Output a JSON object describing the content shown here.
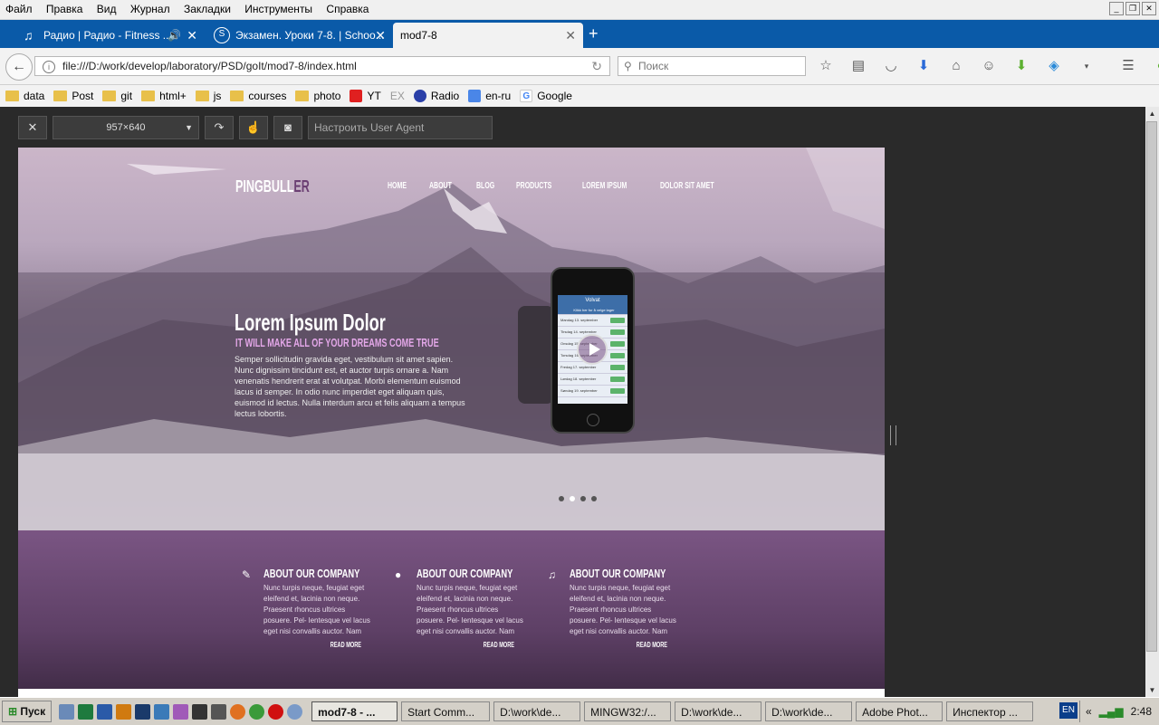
{
  "menu": [
    "Файл",
    "Правка",
    "Вид",
    "Журнал",
    "Закладки",
    "Инструменты",
    "Справка"
  ],
  "tabs": [
    {
      "label": "Радио | Радио - Fitness ...",
      "active": false
    },
    {
      "label": "Экзамен. Уроки 7-8. | Schoo...",
      "active": false
    },
    {
      "label": "mod7-8",
      "active": true
    }
  ],
  "newtab": "+",
  "url": "file:///D:/work/develop/laboratory/PSD/goIt/mod7-8/index.html",
  "search_placeholder": "Поиск",
  "bookmarks": [
    {
      "label": "data",
      "type": "folder"
    },
    {
      "label": "Post",
      "type": "folder"
    },
    {
      "label": "git",
      "type": "folder"
    },
    {
      "label": "html+",
      "type": "folder"
    },
    {
      "label": "js",
      "type": "folder"
    },
    {
      "label": "courses",
      "type": "folder"
    },
    {
      "label": "photo",
      "type": "folder"
    },
    {
      "label": "YT",
      "type": "youtube"
    },
    {
      "label": "EX",
      "type": "text"
    },
    {
      "label": "Radio",
      "type": "radio"
    },
    {
      "label": "en-ru",
      "type": "translate"
    },
    {
      "label": "Google",
      "type": "google"
    }
  ],
  "rdm": {
    "size": "957×640",
    "ua_placeholder": "Настроить User Agent"
  },
  "site": {
    "logo_a": "PINGBULL",
    "logo_b": "ER",
    "nav": [
      "HOME",
      "ABOUT",
      "BLOG",
      "PRODUCTS",
      "LOREM IPSUM",
      "DOLOR SIT AMET"
    ],
    "hero_title": "Lorem Ipsum Dolor",
    "hero_sub": "IT WILL MAKE ALL OF YOUR DREAMS COME TRUE",
    "hero_text": "Semper sollicitudin gravida eget, vestibulum sit amet sapien. Nunc dignissim tincidunt est, et auctor turpis ornare a. Nam venenatis hendrerit erat at volutpat. Morbi elementum euismod lacus id semper. In odio nunc imperdiet eget aliquam quis, euismod id lectus. Nulla interdum arcu et felis aliquam a tempus lectus lobortis.",
    "phone_header": "Volvat",
    "phone_button": "Klikk her for å velge lager",
    "phone_rows": [
      "Mandag 13. september",
      "Tirsdag 14. september",
      "Onsdag 15. september",
      "Torsdag 16. september",
      "Fredag 17. september",
      "Lørdag 18. september",
      "Søndag 19. september"
    ],
    "features": [
      {
        "title": "ABOUT OUR COMPANY",
        "text": "Nunc turpis neque, feugiat eget eleifend et, lacinia non neque. Praesent rhoncus ultrices posuere. Pel- lentesque vel lacus eget nisi convallis auctor. Nam",
        "more": "READ MORE"
      },
      {
        "title": "ABOUT OUR COMPANY",
        "text": "Nunc turpis neque, feugiat eget eleifend et, lacinia non neque. Praesent rhoncus ultrices posuere. Pel- lentesque vel lacus eget nisi convallis auctor. Nam",
        "more": "READ MORE"
      },
      {
        "title": "ABOUT OUR COMPANY",
        "text": "Nunc turpis neque, feugiat eget eleifend et, lacinia non neque. Praesent rhoncus ultrices posuere. Pel- lentesque vel lacus eget nisi convallis auctor. Nam",
        "more": "READ MORE"
      }
    ]
  },
  "taskbar": {
    "start": "Пуск",
    "tasks": [
      "mod7-8 - ...",
      "Start Comm...",
      "D:\\work\\de...",
      "MINGW32:/...",
      "D:\\work\\de...",
      "D:\\work\\de...",
      "Adobe Phot...",
      "Инспектор ..."
    ],
    "active_task_index": 0,
    "lang": "EN",
    "time": "2:48"
  },
  "colors": {
    "tabbar": "#0a5aa8",
    "logo_accent": "#6b3f73",
    "subtitle": "#e3a7e8"
  }
}
